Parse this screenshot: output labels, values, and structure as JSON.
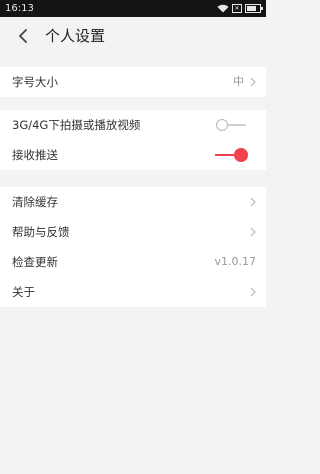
{
  "status_bar": {
    "time": "16:13",
    "sim": "✕"
  },
  "header": {
    "title": "个人设置"
  },
  "groups": [
    {
      "items": [
        {
          "label": "字号大小",
          "value": "中"
        }
      ]
    },
    {
      "items": [
        {
          "label": "3G/4G下拍摄或播放视频",
          "toggle": false
        },
        {
          "label": "接收推送",
          "toggle": true
        }
      ]
    },
    {
      "items": [
        {
          "label": "清除缓存"
        },
        {
          "label": "帮助与反馈"
        },
        {
          "label": "检查更新",
          "value": "v1.0.17"
        },
        {
          "label": "关于"
        }
      ]
    }
  ],
  "colors": {
    "accent": "#f0414c",
    "background": "#f4f3f1",
    "status_bar": "#141414"
  }
}
